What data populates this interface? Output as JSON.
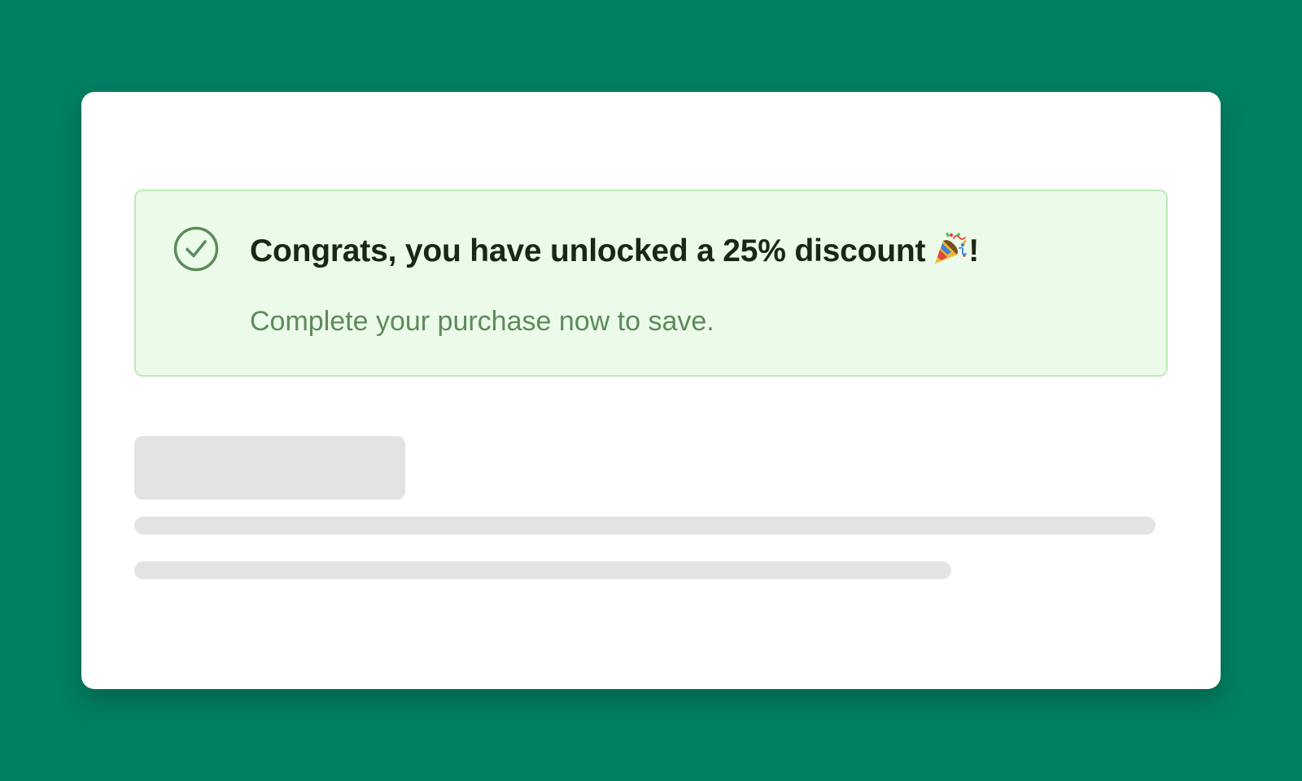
{
  "alert": {
    "title": "Congrats, you have unlocked a 25% discount",
    "title_suffix": "!",
    "subtitle": "Complete your purchase now to save.",
    "icon": "check-circle-icon",
    "title_emoji_icon": "party-popper-icon"
  },
  "colors": {
    "background": "#017f62",
    "card": "#ffffff",
    "alert_background": "#ebfae9",
    "alert_border": "#bfe9b9",
    "alert_title": "#1a2712",
    "alert_subtitle": "#5e8a5b",
    "alert_icon": "#5e8a5b",
    "skeleton": "#e3e3e3"
  },
  "skeleton": {
    "items": [
      "heading-placeholder",
      "line-placeholder",
      "line-placeholder"
    ]
  }
}
